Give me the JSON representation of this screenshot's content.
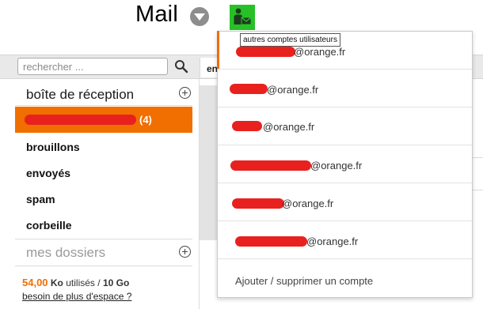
{
  "header": {
    "title": "Mail",
    "menu_icon": "chevron-down-icon",
    "accounts_icon": "user-mail-icon",
    "accounts_tooltip": "autres comptes utilisateurs",
    "accent_color": "#27c127"
  },
  "search": {
    "placeholder": "rechercher ...",
    "value": "",
    "icon": "search-icon"
  },
  "sidebar": {
    "inbox_header": "boîte de réception",
    "active_folder": {
      "count": "(4)",
      "color": "#f16e00"
    },
    "folders": [
      "brouillons",
      "envoyés",
      "spam",
      "corbeille"
    ],
    "my_folders_header": "mes dossiers",
    "storage": {
      "used": "54,00",
      "unit": "Ko",
      "used_label": "utilisés /",
      "total": "10 Go"
    },
    "more_space_link": "besoin de plus d'espace ?"
  },
  "main": {
    "tab_label": "en"
  },
  "accounts_dropdown": {
    "domain": "@orange.fr",
    "accounts": [
      {
        "domain": "@orange.fr"
      },
      {
        "domain": "@orange.fr"
      },
      {
        "domain": "@orange.fr"
      },
      {
        "domain": "@orange.fr"
      },
      {
        "domain": "@orange.fr"
      },
      {
        "domain": "@orange.fr"
      }
    ],
    "action_label": "Ajouter / supprimer un compte",
    "redaction_color": "#e8211f"
  }
}
